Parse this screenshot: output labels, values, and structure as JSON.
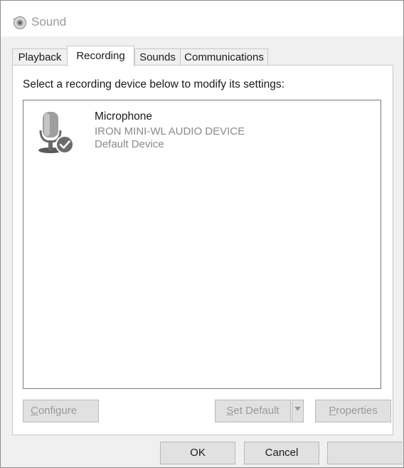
{
  "window": {
    "title": "Sound"
  },
  "tabs": [
    {
      "label": "Playback",
      "active": false
    },
    {
      "label": "Recording",
      "active": true
    },
    {
      "label": "Sounds",
      "active": false
    },
    {
      "label": "Communications",
      "active": false
    }
  ],
  "panel": {
    "instructions": "Select a recording device below to modify its settings:",
    "devices": [
      {
        "name": "Microphone",
        "description": "IRON MINI-WL  AUDIO DEVICE",
        "status": "Default Device",
        "icon": "microphone-default-icon"
      }
    ],
    "buttons": {
      "configure_prefix": "C",
      "configure_rest": "onfigure",
      "set_default_prefix": "S",
      "set_default_rest": "et Default",
      "properties_prefix": "P",
      "properties_rest": "roperties"
    }
  },
  "footer": {
    "ok": "OK",
    "cancel": "Cancel",
    "apply": ""
  },
  "colors": {
    "window_bg": "#f0f0f0",
    "panel_bg": "#ffffff",
    "disabled_text": "#9a9a9a",
    "check_badge": "#6b6b6b"
  }
}
